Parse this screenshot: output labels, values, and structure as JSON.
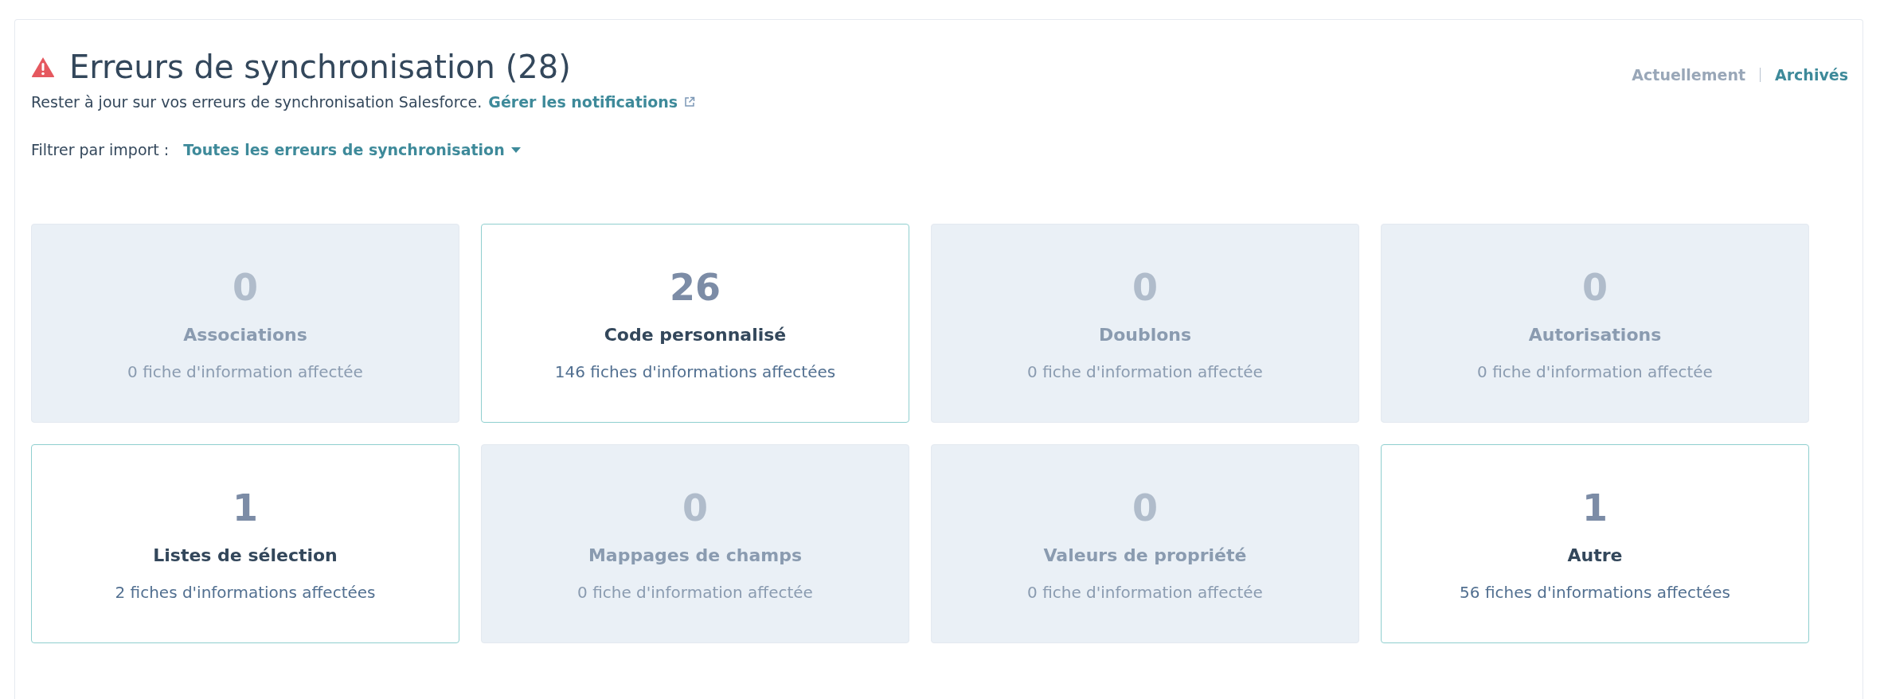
{
  "header": {
    "title": "Erreurs de synchronisation (28)",
    "subtitle": "Rester à jour sur vos erreurs de synchronisation Salesforce.",
    "link": "Gérer les notifications"
  },
  "view_tabs": [
    {
      "label": "Actuellement",
      "selected": true
    },
    {
      "label": "Archivés",
      "selected": false
    }
  ],
  "filter": {
    "label": "Filtrer par import :",
    "value": "Toutes les erreurs de synchronisation"
  },
  "cards": [
    {
      "count": "0",
      "title": "Associations",
      "records": "0 fiche d'information affectée",
      "disabled": true
    },
    {
      "count": "26",
      "title": "Code personnalisé",
      "records": "146 fiches d'informations affectées",
      "disabled": false
    },
    {
      "count": "0",
      "title": "Doublons",
      "records": "0 fiche d'information affectée",
      "disabled": true
    },
    {
      "count": "0",
      "title": "Autorisations",
      "records": "0 fiche d'information affectée",
      "disabled": true
    },
    {
      "count": "1",
      "title": "Listes de sélection",
      "records": "2 fiches d'informations affectées",
      "disabled": false
    },
    {
      "count": "0",
      "title": "Mappages de champs",
      "records": "0 fiche d'information affectée",
      "disabled": true
    },
    {
      "count": "0",
      "title": "Valeurs de propriété",
      "records": "0 fiche d'information affectée",
      "disabled": true
    },
    {
      "count": "1",
      "title": "Autre",
      "records": "56 fiches d'informations affectées",
      "disabled": false
    }
  ]
}
